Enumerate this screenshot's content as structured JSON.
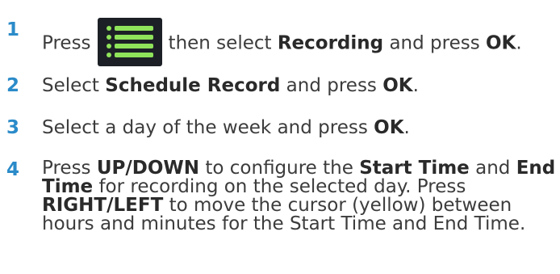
{
  "steps": [
    {
      "number": "1",
      "part1": "Press",
      "part2": "then select",
      "bold1": "Recording",
      "part3": "and press",
      "bold2": "OK",
      "part4": "."
    },
    {
      "number": "2",
      "part1": "Select",
      "bold1": "Schedule Record",
      "part2": "and press",
      "bold2": "OK",
      "part3": "."
    },
    {
      "number": "3",
      "part1": "Select a day of the week and press",
      "bold1": "OK",
      "part2": "."
    },
    {
      "number": "4",
      "part1": "Press",
      "bold1": "UP/DOWN",
      "part2": "to configure the",
      "bold2": "Start Time",
      "part3": "and",
      "bold3": "End Time",
      "part4": "for recording on the selected day. Press",
      "bold4": "RIGHT/LEFT",
      "part5": "to move the cursor (yellow) between hours and minutes for the Start Time and End Time."
    }
  ],
  "icons": {
    "menu": "menu-list-icon"
  },
  "colors": {
    "step_number": "#2b8bc9",
    "text": "#3c3c3c",
    "icon_background": "#1c2026",
    "icon_accent": "#8fe35a"
  }
}
